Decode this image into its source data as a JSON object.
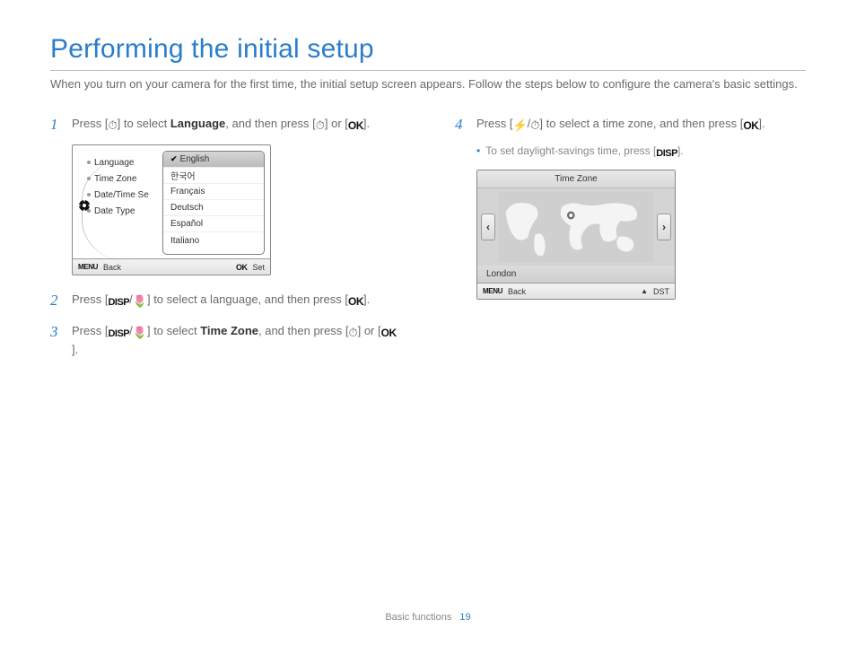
{
  "title": "Performing the initial setup",
  "intro": "When you turn on your camera for the first time, the initial setup screen appears. Follow the steps below to configure the camera's basic settings.",
  "icons": {
    "timer": "⏱",
    "ok": "OK",
    "disp": "DISP",
    "macro": "🌷",
    "flash": "⚡",
    "menu": "MENU",
    "up": "▲",
    "arrow_left": "‹",
    "arrow_right": "›",
    "check": "✔",
    "gear": "⚙"
  },
  "steps": {
    "s1": {
      "num": "1",
      "pre": "Press [",
      "mid1": "] to select ",
      "bold": "Language",
      "mid2": ", and then press [",
      "or": "] or [",
      "end": "]."
    },
    "s2": {
      "num": "2",
      "pre": "Press [",
      "slash": "/",
      "mid": "] to select a language, and then press [",
      "end": "]."
    },
    "s3": {
      "num": "3",
      "pre": "Press [",
      "slash": "/",
      "mid1": "] to select ",
      "bold": "Time Zone",
      "mid2": ", and then press [",
      "or": "] or [",
      "end": "]."
    },
    "s4": {
      "num": "4",
      "pre": "Press [",
      "slash": "/",
      "mid": "] to select a time zone, and then press [",
      "end": "].",
      "sub": "To set daylight-savings time, press [",
      "sub_end": "]."
    }
  },
  "lang_menu": {
    "left": [
      "Language",
      "Time Zone",
      "Date/Time Se",
      "Date Type"
    ],
    "options": [
      "English",
      "한국어",
      "Français",
      "Deutsch",
      "Español",
      "Italiano"
    ],
    "footer_back": "Back",
    "footer_set": "Set"
  },
  "timezone": {
    "title": "Time Zone",
    "city": "London",
    "footer_back": "Back",
    "footer_dst": "DST"
  },
  "footer": {
    "section": "Basic functions",
    "page": "19"
  }
}
